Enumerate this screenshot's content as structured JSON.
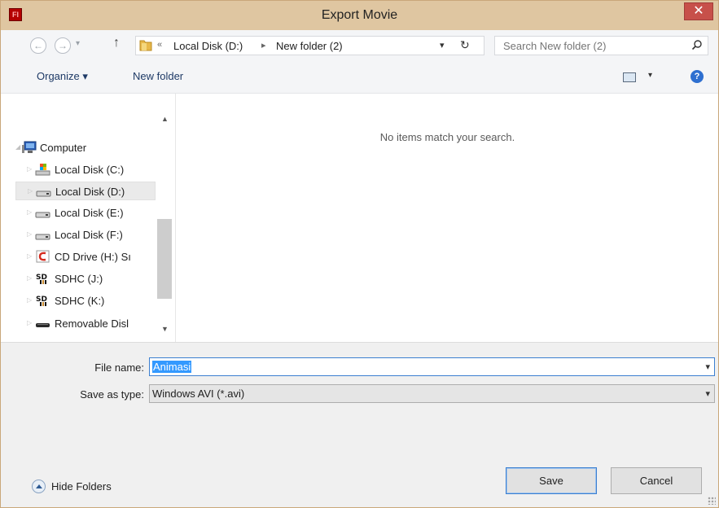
{
  "window": {
    "title": "Export Movie",
    "app_icon_text": "Fl",
    "close_glyph": "✕"
  },
  "nav": {
    "back": "←",
    "forward": "→",
    "dropdown": "▾",
    "up": "↑"
  },
  "address": {
    "overflow": "«",
    "crumbs": [
      "Local Disk (D:)",
      "New folder (2)"
    ],
    "separator": "▸",
    "dropdown": "▾",
    "refresh": "↻"
  },
  "search": {
    "placeholder": "Search New folder (2)"
  },
  "toolbar": {
    "organize": "Organize ▾",
    "new_folder": "New folder",
    "view_dropdown": "▾",
    "help": "?"
  },
  "tree": {
    "items": [
      {
        "label": "Computer",
        "icon": "computer-icon",
        "expander": "◢"
      },
      {
        "label": "Local Disk (C:)",
        "icon": "system-drive-icon",
        "expander": "▷"
      },
      {
        "label": "Local Disk (D:)",
        "icon": "drive-icon",
        "expander": "▷",
        "selected": true
      },
      {
        "label": "Local Disk (E:)",
        "icon": "drive-icon",
        "expander": "▷"
      },
      {
        "label": "Local Disk (F:)",
        "icon": "drive-icon",
        "expander": "▷"
      },
      {
        "label": "CD Drive (H:) Sı",
        "icon": "cd-drive-icon",
        "expander": "▷"
      },
      {
        "label": "SDHC (J:)",
        "icon": "sd-card-icon",
        "expander": "▷"
      },
      {
        "label": "SDHC (K:)",
        "icon": "sd-card-icon",
        "expander": "▷"
      },
      {
        "label": "Removable Disl",
        "icon": "removable-drive-icon",
        "expander": "▷"
      }
    ],
    "scroll_up": "▲",
    "scroll_down": "▼"
  },
  "content": {
    "empty_message": "No items match your search."
  },
  "form": {
    "file_name_label": "File name:",
    "file_name_value": "Animasi",
    "save_type_label": "Save as type:",
    "save_type_value": "Windows AVI (*.avi)",
    "dropdown": "▾"
  },
  "footer": {
    "hide_folders": "Hide Folders",
    "save": "Save",
    "cancel": "Cancel"
  },
  "colors": {
    "titlebar": "#dfc6a1",
    "close": "#c7504a",
    "selection": "#3399ff",
    "accent": "#3c7fd0"
  }
}
